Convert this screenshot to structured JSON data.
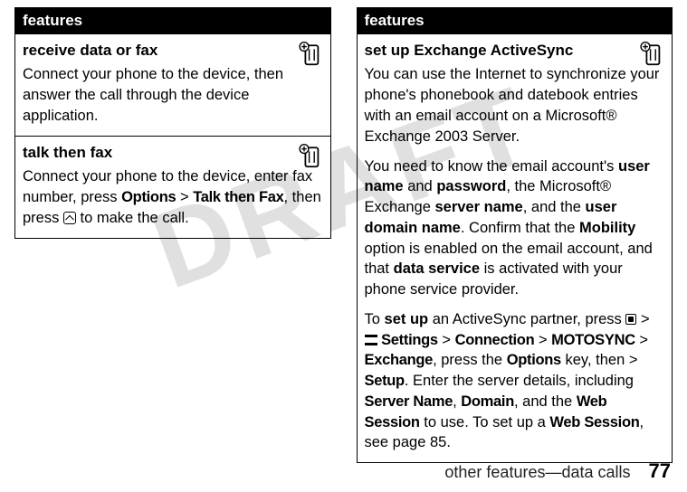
{
  "watermark": "DRAFT",
  "columns": {
    "left": {
      "header": "features",
      "cells": [
        {
          "title": "receive data or fax",
          "body": "Connect your phone to the device, then answer the call through the device application."
        },
        {
          "title": "talk then fax",
          "body_parts": {
            "p1": "Connect your phone to the device, enter fax number, press ",
            "m1": "Options",
            "gt1": " > ",
            "m2": "Talk then Fax",
            "p2": ", then press ",
            "p3": " to make the call."
          }
        }
      ]
    },
    "right": {
      "header": "features",
      "cell": {
        "title": "set up Exchange ActiveSync",
        "p1": "You can use the Internet to synchronize your phone's phonebook and datebook entries with an email account on a Microsoft® Exchange 2003 Server.",
        "p2a": "You need to know the email account's ",
        "b1": "user name",
        "p2b": " and ",
        "b2": "password",
        "p2c": ", the Microsoft® Exchange ",
        "b3": "server name",
        "p2d": ", and the ",
        "b4": "user domain name",
        "p2e": ". Confirm that the ",
        "b5": "Mobility",
        "p2f": " option is enabled on the email account, and that ",
        "b6": "data service",
        "p2g": " is activated with your phone service provider.",
        "p3a": "To ",
        "b7": "set up",
        "p3b": " an ActiveSync partner, press ",
        "gt1": " > ",
        "m1": "Settings",
        "gt2": " > ",
        "m2": "Connection",
        "gt3": " > ",
        "m3": "MOTOSYNC",
        "gt4": " > ",
        "m4": "Exchange",
        "p3c": ", press the ",
        "m5": "Options",
        "p3d": " key, then > ",
        "m6": "Setup",
        "p3e": ". Enter the server details, including ",
        "m7": "Server Name",
        "p3f": ", ",
        "m8": "Domain",
        "p3g": ", and the ",
        "m9": "Web Session",
        "p3h": " to use. To set up a ",
        "m10": "Web Session",
        "p3i": ", see page 85."
      }
    }
  },
  "footer": {
    "label": "other features—data calls",
    "page": "77"
  }
}
